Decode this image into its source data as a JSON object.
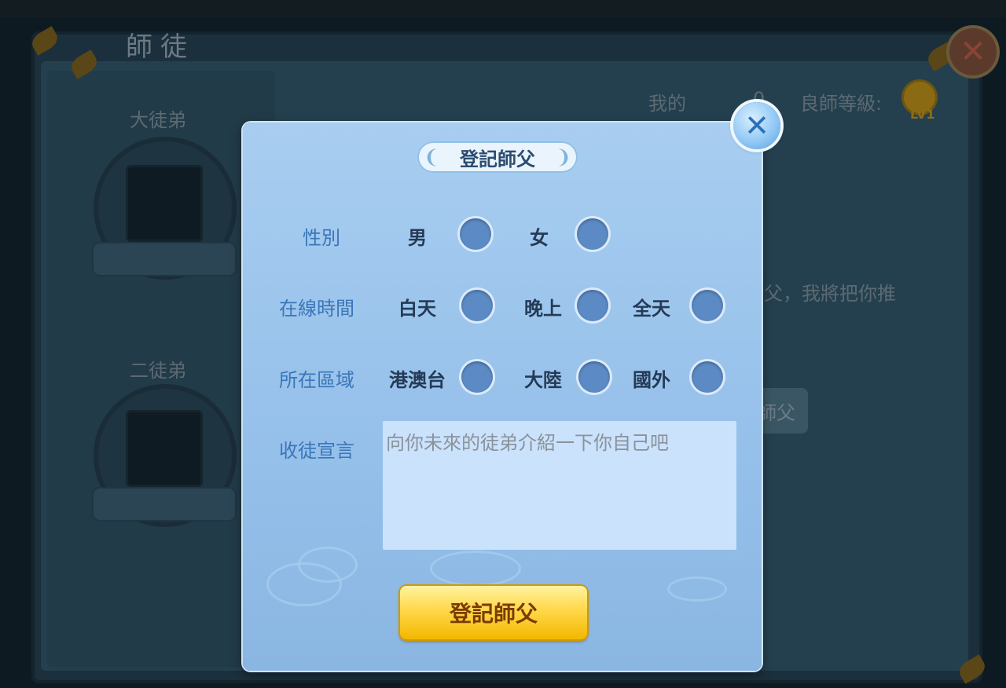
{
  "background": {
    "title": "師徒",
    "slots": [
      {
        "label": "大徒弟"
      },
      {
        "label": "二徒弟"
      }
    ],
    "my_label": "我的",
    "my_value": "0",
    "teacher_level_label": "良師等級:",
    "teacher_level": "LV1",
    "hint_text": "父，我將把你推",
    "hint_button": "師父"
  },
  "modal": {
    "title": "登記師父",
    "rows": [
      {
        "label": "性別",
        "options": [
          "男",
          "女"
        ]
      },
      {
        "label": "在線時間",
        "options": [
          "白天",
          "晚上",
          "全天"
        ]
      },
      {
        "label": "所在區域",
        "options": [
          "港澳台",
          "大陸",
          "國外"
        ]
      }
    ],
    "declaration_label": "收徒宣言",
    "declaration_placeholder": "向你未來的徒弟介紹一下你自己吧",
    "submit_label": "登記師父"
  },
  "colors": {
    "modal_bg": "#a8cdf0",
    "radio_fill": "#5b8ac4",
    "submit_gold": "#ffd84a",
    "label_blue": "#3a76b8"
  },
  "icons": {
    "close": "close-icon",
    "gold_coin": "coin-icon"
  }
}
